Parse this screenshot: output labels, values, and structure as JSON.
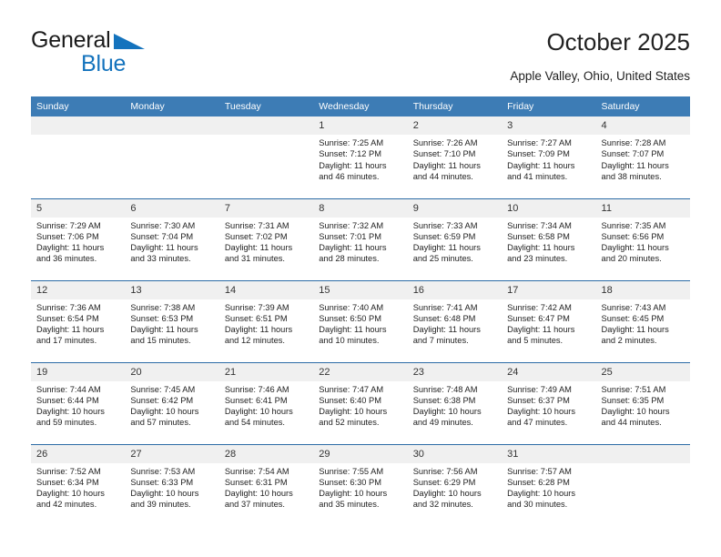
{
  "logo": {
    "word1": "General",
    "word2": "Blue",
    "triangle_icon": "blue-triangle-icon",
    "color_black": "#1a1a1a",
    "color_blue": "#1473bd"
  },
  "header": {
    "title": "October 2025",
    "location": "Apple Valley, Ohio, United States"
  },
  "calendar": {
    "header_bg": "#3d7cb5",
    "row_divider": "#2c6ca6",
    "daynum_bg": "#f0f0f0",
    "weekday_headers": [
      "Sunday",
      "Monday",
      "Tuesday",
      "Wednesday",
      "Thursday",
      "Friday",
      "Saturday"
    ],
    "weeks": [
      [
        {
          "day": "",
          "lines": []
        },
        {
          "day": "",
          "lines": []
        },
        {
          "day": "",
          "lines": []
        },
        {
          "day": "1",
          "lines": [
            "Sunrise: 7:25 AM",
            "Sunset: 7:12 PM",
            "Daylight: 11 hours",
            "and 46 minutes."
          ]
        },
        {
          "day": "2",
          "lines": [
            "Sunrise: 7:26 AM",
            "Sunset: 7:10 PM",
            "Daylight: 11 hours",
            "and 44 minutes."
          ]
        },
        {
          "day": "3",
          "lines": [
            "Sunrise: 7:27 AM",
            "Sunset: 7:09 PM",
            "Daylight: 11 hours",
            "and 41 minutes."
          ]
        },
        {
          "day": "4",
          "lines": [
            "Sunrise: 7:28 AM",
            "Sunset: 7:07 PM",
            "Daylight: 11 hours",
            "and 38 minutes."
          ]
        }
      ],
      [
        {
          "day": "5",
          "lines": [
            "Sunrise: 7:29 AM",
            "Sunset: 7:06 PM",
            "Daylight: 11 hours",
            "and 36 minutes."
          ]
        },
        {
          "day": "6",
          "lines": [
            "Sunrise: 7:30 AM",
            "Sunset: 7:04 PM",
            "Daylight: 11 hours",
            "and 33 minutes."
          ]
        },
        {
          "day": "7",
          "lines": [
            "Sunrise: 7:31 AM",
            "Sunset: 7:02 PM",
            "Daylight: 11 hours",
            "and 31 minutes."
          ]
        },
        {
          "day": "8",
          "lines": [
            "Sunrise: 7:32 AM",
            "Sunset: 7:01 PM",
            "Daylight: 11 hours",
            "and 28 minutes."
          ]
        },
        {
          "day": "9",
          "lines": [
            "Sunrise: 7:33 AM",
            "Sunset: 6:59 PM",
            "Daylight: 11 hours",
            "and 25 minutes."
          ]
        },
        {
          "day": "10",
          "lines": [
            "Sunrise: 7:34 AM",
            "Sunset: 6:58 PM",
            "Daylight: 11 hours",
            "and 23 minutes."
          ]
        },
        {
          "day": "11",
          "lines": [
            "Sunrise: 7:35 AM",
            "Sunset: 6:56 PM",
            "Daylight: 11 hours",
            "and 20 minutes."
          ]
        }
      ],
      [
        {
          "day": "12",
          "lines": [
            "Sunrise: 7:36 AM",
            "Sunset: 6:54 PM",
            "Daylight: 11 hours",
            "and 17 minutes."
          ]
        },
        {
          "day": "13",
          "lines": [
            "Sunrise: 7:38 AM",
            "Sunset: 6:53 PM",
            "Daylight: 11 hours",
            "and 15 minutes."
          ]
        },
        {
          "day": "14",
          "lines": [
            "Sunrise: 7:39 AM",
            "Sunset: 6:51 PM",
            "Daylight: 11 hours",
            "and 12 minutes."
          ]
        },
        {
          "day": "15",
          "lines": [
            "Sunrise: 7:40 AM",
            "Sunset: 6:50 PM",
            "Daylight: 11 hours",
            "and 10 minutes."
          ]
        },
        {
          "day": "16",
          "lines": [
            "Sunrise: 7:41 AM",
            "Sunset: 6:48 PM",
            "Daylight: 11 hours",
            "and 7 minutes."
          ]
        },
        {
          "day": "17",
          "lines": [
            "Sunrise: 7:42 AM",
            "Sunset: 6:47 PM",
            "Daylight: 11 hours",
            "and 5 minutes."
          ]
        },
        {
          "day": "18",
          "lines": [
            "Sunrise: 7:43 AM",
            "Sunset: 6:45 PM",
            "Daylight: 11 hours",
            "and 2 minutes."
          ]
        }
      ],
      [
        {
          "day": "19",
          "lines": [
            "Sunrise: 7:44 AM",
            "Sunset: 6:44 PM",
            "Daylight: 10 hours",
            "and 59 minutes."
          ]
        },
        {
          "day": "20",
          "lines": [
            "Sunrise: 7:45 AM",
            "Sunset: 6:42 PM",
            "Daylight: 10 hours",
            "and 57 minutes."
          ]
        },
        {
          "day": "21",
          "lines": [
            "Sunrise: 7:46 AM",
            "Sunset: 6:41 PM",
            "Daylight: 10 hours",
            "and 54 minutes."
          ]
        },
        {
          "day": "22",
          "lines": [
            "Sunrise: 7:47 AM",
            "Sunset: 6:40 PM",
            "Daylight: 10 hours",
            "and 52 minutes."
          ]
        },
        {
          "day": "23",
          "lines": [
            "Sunrise: 7:48 AM",
            "Sunset: 6:38 PM",
            "Daylight: 10 hours",
            "and 49 minutes."
          ]
        },
        {
          "day": "24",
          "lines": [
            "Sunrise: 7:49 AM",
            "Sunset: 6:37 PM",
            "Daylight: 10 hours",
            "and 47 minutes."
          ]
        },
        {
          "day": "25",
          "lines": [
            "Sunrise: 7:51 AM",
            "Sunset: 6:35 PM",
            "Daylight: 10 hours",
            "and 44 minutes."
          ]
        }
      ],
      [
        {
          "day": "26",
          "lines": [
            "Sunrise: 7:52 AM",
            "Sunset: 6:34 PM",
            "Daylight: 10 hours",
            "and 42 minutes."
          ]
        },
        {
          "day": "27",
          "lines": [
            "Sunrise: 7:53 AM",
            "Sunset: 6:33 PM",
            "Daylight: 10 hours",
            "and 39 minutes."
          ]
        },
        {
          "day": "28",
          "lines": [
            "Sunrise: 7:54 AM",
            "Sunset: 6:31 PM",
            "Daylight: 10 hours",
            "and 37 minutes."
          ]
        },
        {
          "day": "29",
          "lines": [
            "Sunrise: 7:55 AM",
            "Sunset: 6:30 PM",
            "Daylight: 10 hours",
            "and 35 minutes."
          ]
        },
        {
          "day": "30",
          "lines": [
            "Sunrise: 7:56 AM",
            "Sunset: 6:29 PM",
            "Daylight: 10 hours",
            "and 32 minutes."
          ]
        },
        {
          "day": "31",
          "lines": [
            "Sunrise: 7:57 AM",
            "Sunset: 6:28 PM",
            "Daylight: 10 hours",
            "and 30 minutes."
          ]
        },
        {
          "day": "",
          "lines": []
        }
      ]
    ]
  }
}
